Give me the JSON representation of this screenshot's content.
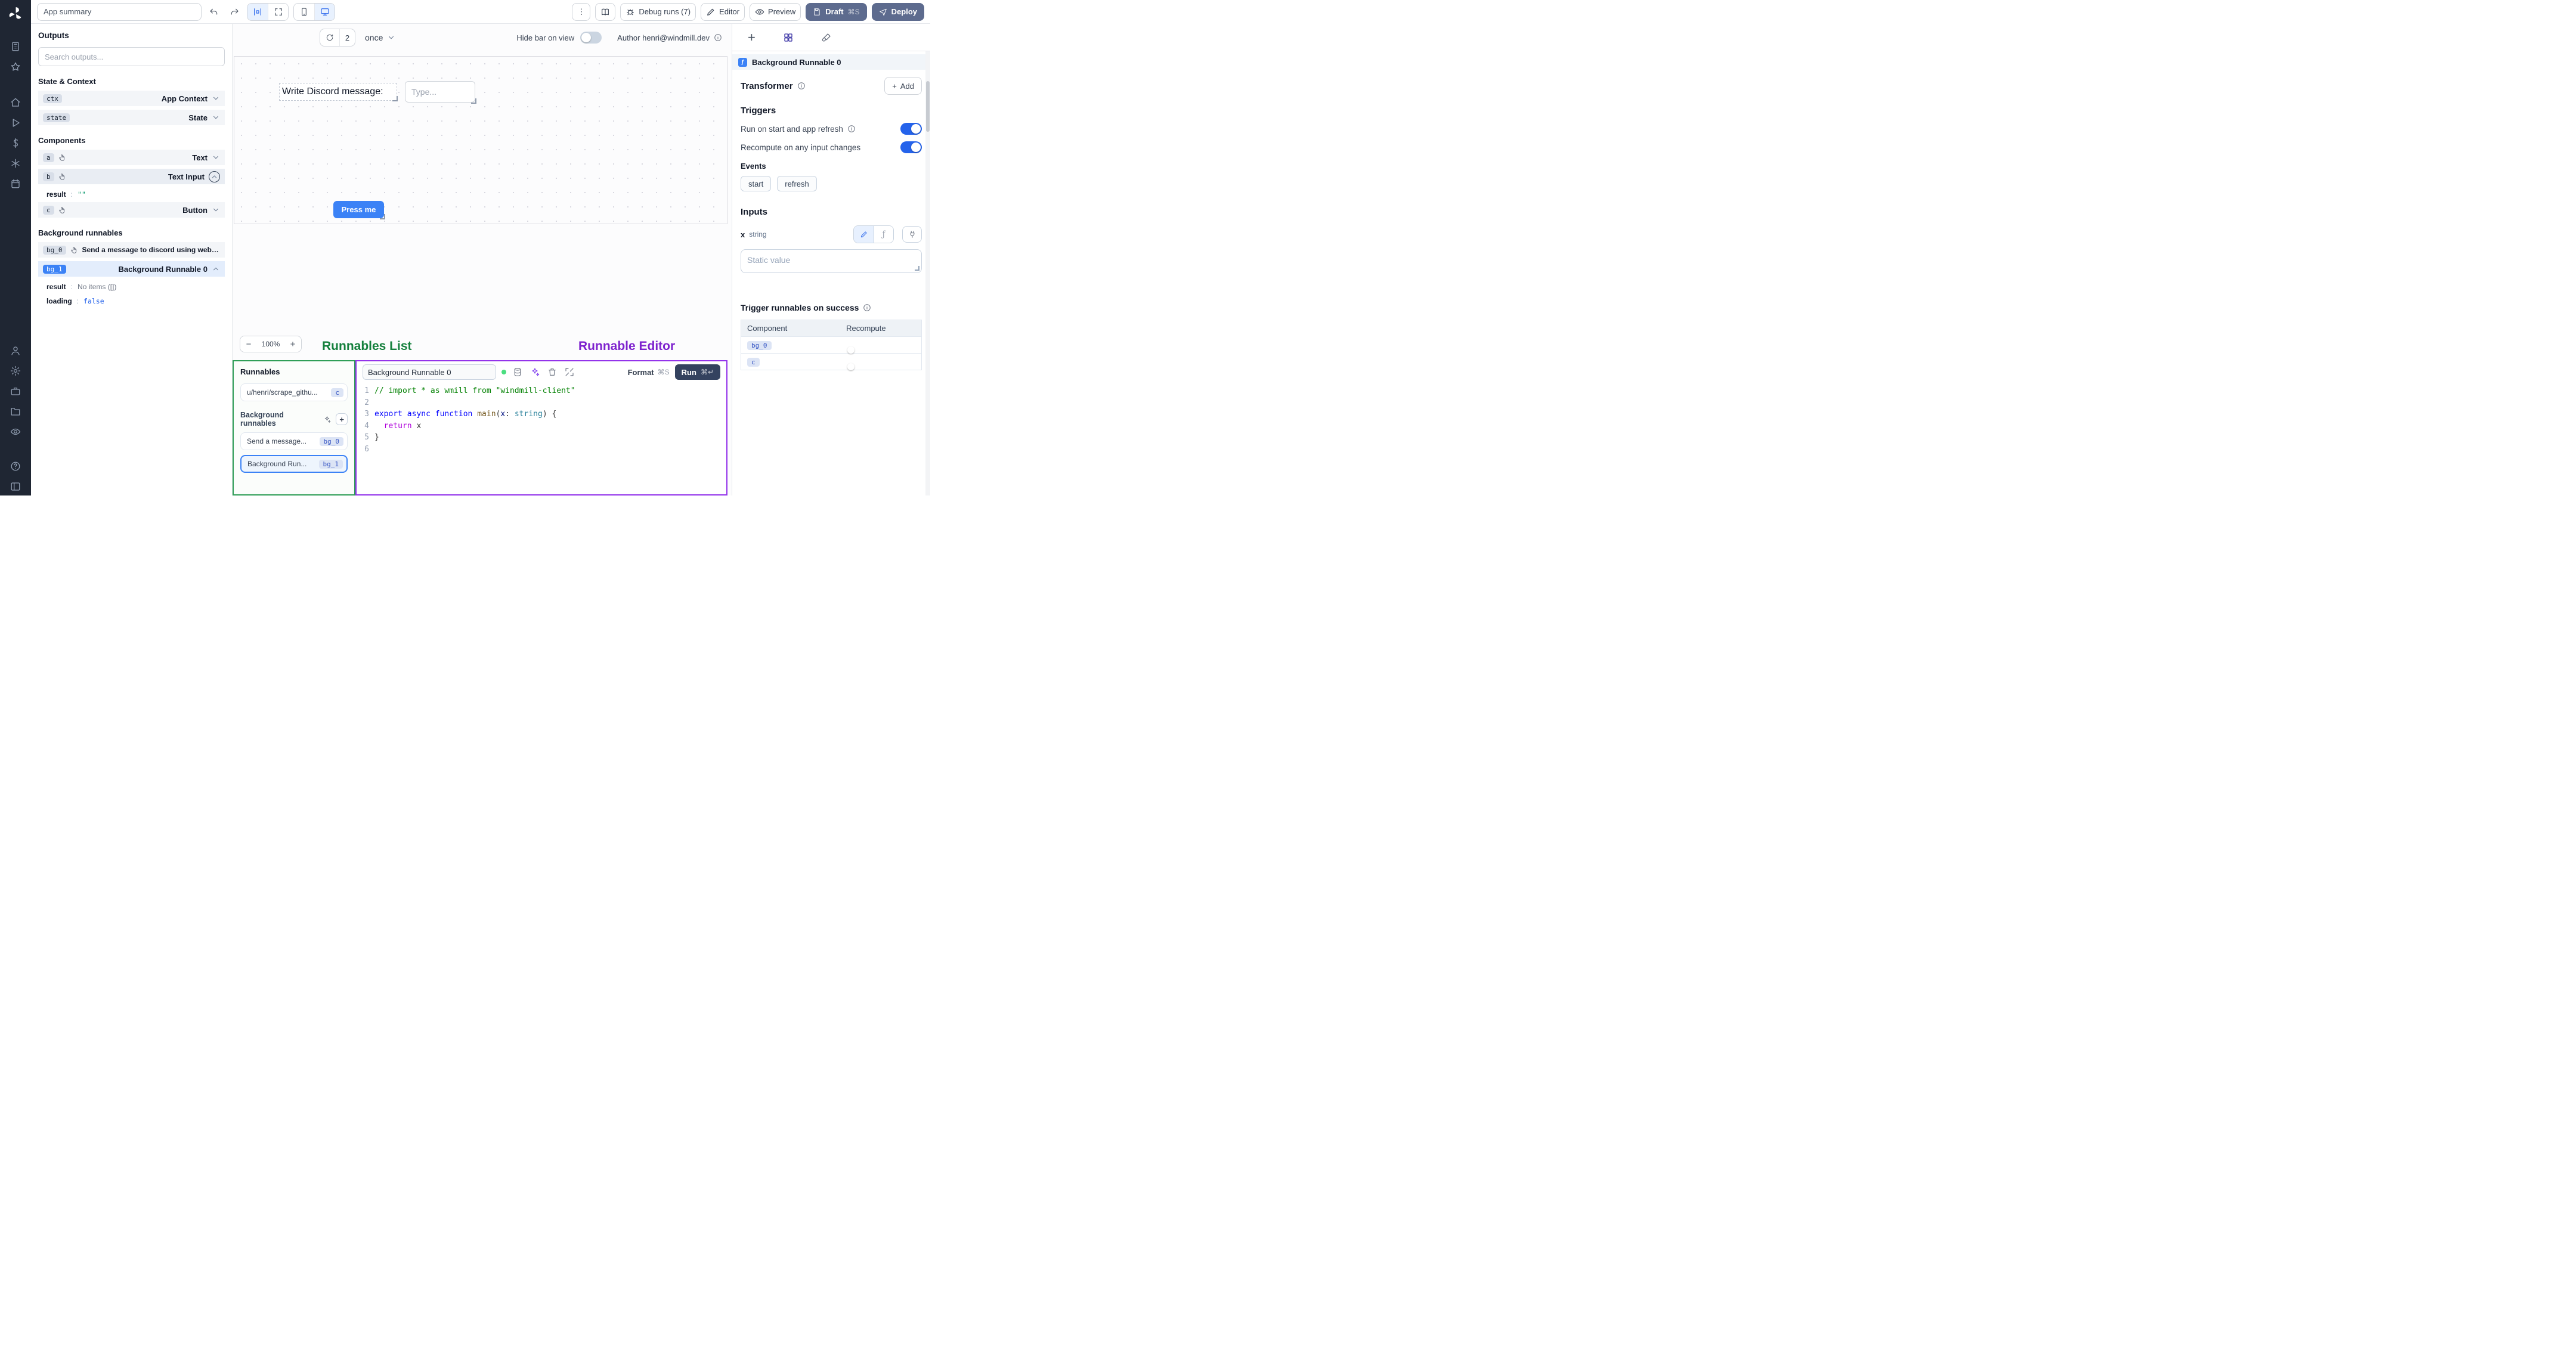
{
  "colors": {
    "accent": "#3b82f6",
    "green_annotation": "#15803d",
    "purple_annotation": "#7e22ce",
    "slate_button": "#5d6b8e",
    "toggle_on": "#2563eb"
  },
  "topbar": {
    "app_summary": "App summary",
    "more_label": "⋮",
    "debug_runs_label": "Debug runs (7)",
    "editor_label": "Editor",
    "preview_label": "Preview",
    "draft_label": "Draft",
    "draft_shortcut": "⌘S",
    "deploy_label": "Deploy"
  },
  "canvas_toolbar": {
    "refresh_count": "2",
    "frequency": "once",
    "hide_bar_label": "Hide bar on view",
    "author_label": "Author henri@windmill.dev"
  },
  "canvas": {
    "text_component": "Write Discord message:",
    "input_placeholder": "Type...",
    "button_label": "Press me",
    "zoom_out": "−",
    "zoom_level": "100%",
    "zoom_in": "+"
  },
  "annotations": {
    "runnables_list": "Runnables List",
    "runnable_editor": "Runnable Editor"
  },
  "outputs": {
    "title": "Outputs",
    "search_placeholder": "Search outputs...",
    "state_context_header": "State & Context",
    "components_header": "Components",
    "background_header": "Background runnables",
    "colon": ":",
    "ctx": {
      "id": "ctx",
      "label": "App Context"
    },
    "state": {
      "id": "state",
      "label": "State"
    },
    "a": {
      "id": "a",
      "label": "Text"
    },
    "b": {
      "id": "b",
      "label": "Text Input"
    },
    "b_result": {
      "key": "result",
      "value": "\"\""
    },
    "c": {
      "id": "c",
      "label": "Button"
    },
    "bg0": {
      "id": "bg_0",
      "label": "Send a message to discord using webhoo"
    },
    "bg1": {
      "id": "bg_1",
      "label": "Background Runnable 0"
    },
    "bg1_result": {
      "key": "result",
      "value": "No items ([])"
    },
    "bg1_loading": {
      "key": "loading",
      "value": "false"
    }
  },
  "runnables": {
    "title": "Runnables",
    "item_script": {
      "label": "u/henri/scrape_githu...",
      "badge": "c"
    },
    "group_label": "Background runnables",
    "item_bg0": {
      "label": "Send a message...",
      "badge": "bg_0"
    },
    "item_bg1": {
      "label": "Background Run...",
      "badge": "bg_1"
    }
  },
  "editor": {
    "name_value": "Background Runnable 0",
    "format_label": "Format",
    "format_shortcut": "⌘S",
    "run_label": "Run",
    "run_shortcut": "⌘↵"
  },
  "code": {
    "line_numbers": [
      "1",
      "2",
      "3",
      "4",
      "5",
      "6"
    ],
    "lines": [
      [
        [
          "// import * as wmill from \"windmill-client\"",
          "comment"
        ]
      ],
      [],
      [
        [
          "export",
          "kw"
        ],
        [
          " ",
          "p"
        ],
        [
          "async",
          "kw"
        ],
        [
          " ",
          "p"
        ],
        [
          "function",
          "kw"
        ],
        [
          " ",
          "p"
        ],
        [
          "main",
          "fn"
        ],
        [
          "(",
          "p"
        ],
        [
          "x",
          "param"
        ],
        [
          ":",
          "p"
        ],
        [
          " ",
          "p"
        ],
        [
          "string",
          "type"
        ],
        [
          ")",
          "p"
        ],
        [
          " {",
          "p"
        ]
      ],
      [
        [
          "  ",
          "p"
        ],
        [
          "return",
          "ctrl"
        ],
        [
          " x",
          "p"
        ]
      ],
      [
        [
          "}",
          "p"
        ]
      ],
      []
    ]
  },
  "settings": {
    "component_title": "Background Runnable 0",
    "transformer_label": "Transformer",
    "plus": "+",
    "add_label": "Add",
    "triggers_label": "Triggers",
    "run_on_start_label": "Run on start and app refresh",
    "recompute_label": "Recompute on any input changes",
    "events_label": "Events",
    "event_start": "start",
    "event_refresh": "refresh",
    "inputs_label": "Inputs",
    "input_name": "x",
    "input_type": "string",
    "static_placeholder": "Static value",
    "trigger_success_label": "Trigger runnables on success",
    "table": {
      "component_col": "Component",
      "recompute_col": "Recompute",
      "rows": [
        {
          "badge": "bg_0"
        },
        {
          "badge": "c"
        }
      ]
    }
  }
}
